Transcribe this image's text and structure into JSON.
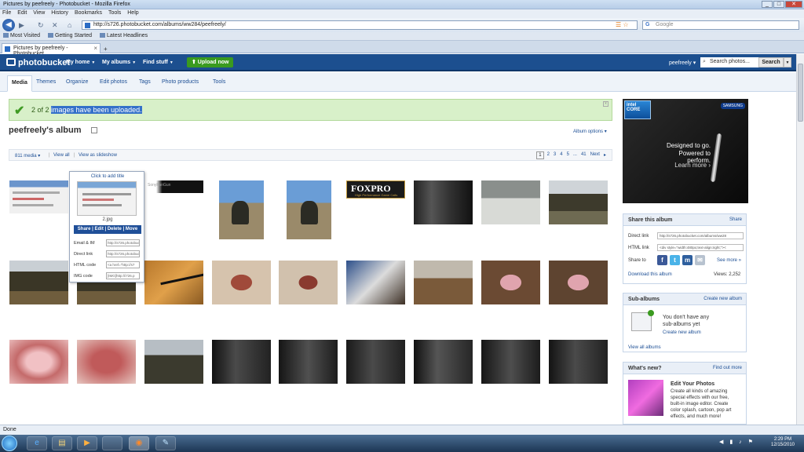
{
  "window": {
    "title": "Pictures by peefreely - Photobucket - Mozilla Firefox",
    "min": "_",
    "max": "□",
    "close": "✕"
  },
  "menu": [
    "File",
    "Edit",
    "View",
    "History",
    "Bookmarks",
    "Tools",
    "Help"
  ],
  "nav": {
    "url": "http://s726.photobucket.com/albums/ww284/peefreely/",
    "search_placeholder": "Google",
    "back_glyph": "◀",
    "forward_glyph": "▶",
    "reload_glyph": "↻",
    "stop_glyph": "✕",
    "home_glyph": "⌂",
    "feed_glyph": "☰ ☆"
  },
  "bookmarks": [
    "Most Visited",
    "Getting Started",
    "Latest Headlines"
  ],
  "tabs": [
    {
      "label": "Pictures by peefreely - Photobucket",
      "close": "×"
    }
  ],
  "newtab": "+",
  "pb": {
    "logo": "photobucket",
    "menu": [
      {
        "label": "My home"
      },
      {
        "label": "My albums"
      },
      {
        "label": "Find stuff"
      }
    ],
    "dd": "▼",
    "upload": "⬆ Upload now",
    "user": "peefreely ▾",
    "search_placeholder": "Search photos...",
    "search_button": "Search",
    "search_dd": "▼",
    "mag": "⌕"
  },
  "subnav": [
    "Media",
    "Themes",
    "Organize",
    "Edit photos",
    "Tags",
    "Photo products",
    "Tools"
  ],
  "notice": {
    "check": "✔",
    "prefix": "2 of 2 ",
    "highlight": "images have been uploaded.",
    "close": "x"
  },
  "album": {
    "title": "peefreely's album",
    "options": "Album options ▾"
  },
  "toolbar": {
    "media": "811 media ▾",
    "view_all": "View all",
    "slideshow": "View as slideshow",
    "sep": "|",
    "pages": [
      "1",
      "2",
      "3",
      "4",
      "5",
      "...",
      "41",
      "Next",
      "▸"
    ]
  },
  "thumbs": {
    "foxpro": "FOXPRO",
    "foxpro_sub": "High Performance Game Calls",
    "banner_text": "SonyFanGun"
  },
  "popup": {
    "title": "Click to add title",
    "file": "2.jpg",
    "actions": "Share | Edit | Delete | Move",
    "rows": [
      {
        "label": "Email & IM",
        "value": "http://s726.photobuck"
      },
      {
        "label": "Direct link",
        "value": "http://s726.photobuc"
      },
      {
        "label": "HTML code",
        "value": "<a href=\"http://s7"
      },
      {
        "label": "IMG code",
        "value": "[IMG]http://i726.p"
      }
    ]
  },
  "ad": {
    "intel": "intel CORE",
    "brand": "SAMSUNG",
    "line1": "Designed to go.",
    "line2": "Powered to perform.",
    "line3": "Learn more ›"
  },
  "share": {
    "title": "Share this album",
    "link": "Share",
    "direct_label": "Direct link",
    "direct_value": "http://s726.photobucket.com/albums/ww28",
    "html_label": "HTML link",
    "html_value": "<div style=\"width:480px;text-align:right;\"><",
    "share_label": "Share to",
    "see_more": "See more »",
    "download": "Download this album",
    "views": "Views: 2,252",
    "icons": {
      "facebook": "f",
      "twitter": "t",
      "myspace": "m",
      "email": "✉"
    }
  },
  "subalbums": {
    "title": "Sub-albums",
    "create": "Create new album",
    "empty1": "You don't have any",
    "empty2": "sub-albums yet",
    "create2": "Create new album",
    "view_all": "View all albums"
  },
  "whatsnew": {
    "title": "What's new?",
    "find": "Find out more",
    "heading": "Edit Your Photos",
    "body1": "Create all kinds of amazing",
    "body2": "special effects with our free,",
    "body3": "built-in image editor. Create",
    "body4": "color splash, cartoon, pop art",
    "body5": "effects, and much more!"
  },
  "status": "Done",
  "taskbar": {
    "ie": "e",
    "folder": "▤",
    "media": "▶",
    "firefox": "◉",
    "app": "✎",
    "tray": "◀ ▮ ♪ ⚑",
    "time": "2:29 PM",
    "date": "12/15/2010"
  },
  "colors": {
    "brand_blue": "#1c4f8f",
    "notice_green": "#d8f0c9",
    "link": "#1d4f95"
  }
}
